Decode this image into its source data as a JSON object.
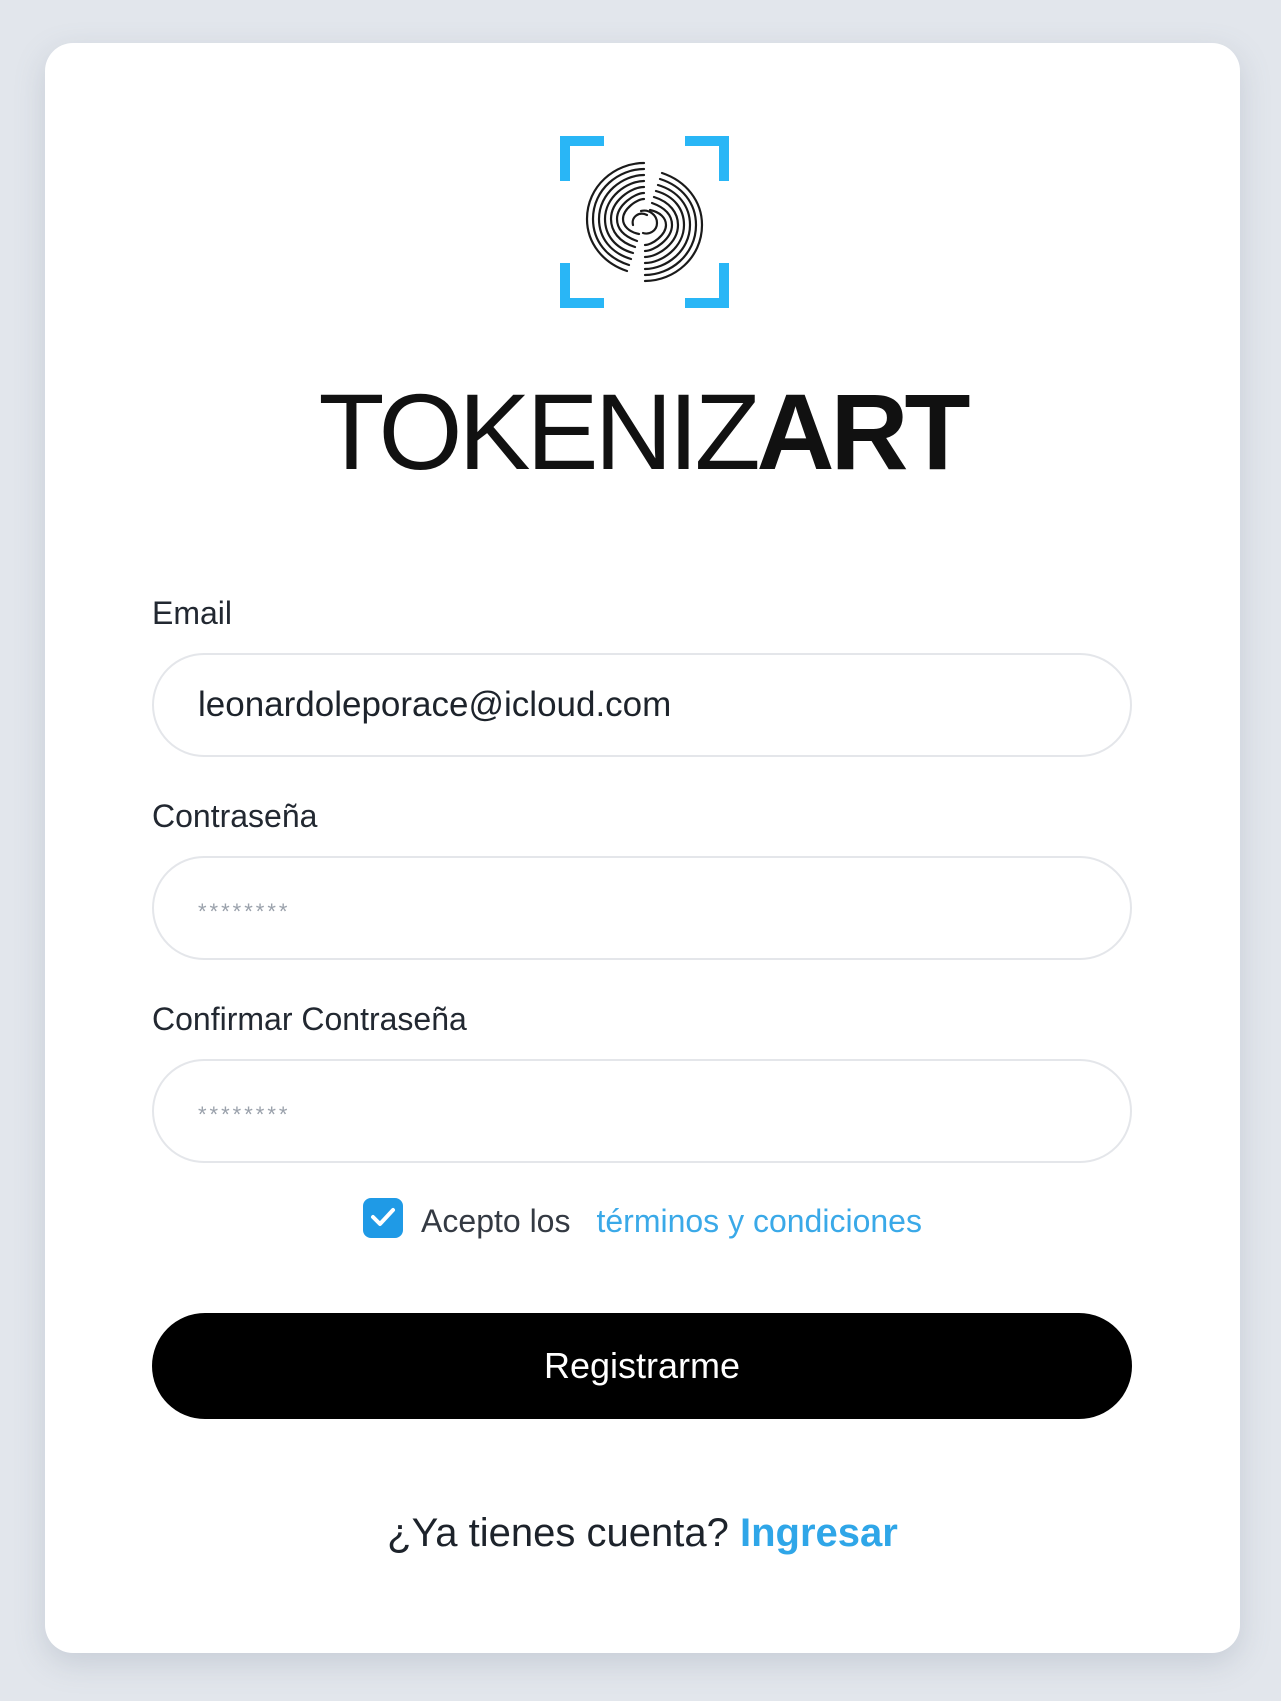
{
  "brand": {
    "name_light": "TOKENIZ",
    "name_bold": "ART",
    "accent_color": "#29b6f6",
    "icon": "fingerprint-scan-icon"
  },
  "form": {
    "email": {
      "label": "Email",
      "value": "leonardoleporace@icloud.com"
    },
    "password": {
      "label": "Contraseña",
      "placeholder": "********"
    },
    "confirm_password": {
      "label": "Confirmar Contraseña",
      "placeholder": "********"
    },
    "terms": {
      "checked": true,
      "text": "Acepto los",
      "link": "términos y condiciones"
    },
    "submit_label": "Registrarme"
  },
  "footer": {
    "prompt": "¿Ya tienes cuenta?",
    "link": "Ingresar"
  },
  "colors": {
    "link": "#3aa9e8",
    "button": "#000000",
    "checkbox": "#1f9ae6",
    "background": "#e2e6ec"
  }
}
